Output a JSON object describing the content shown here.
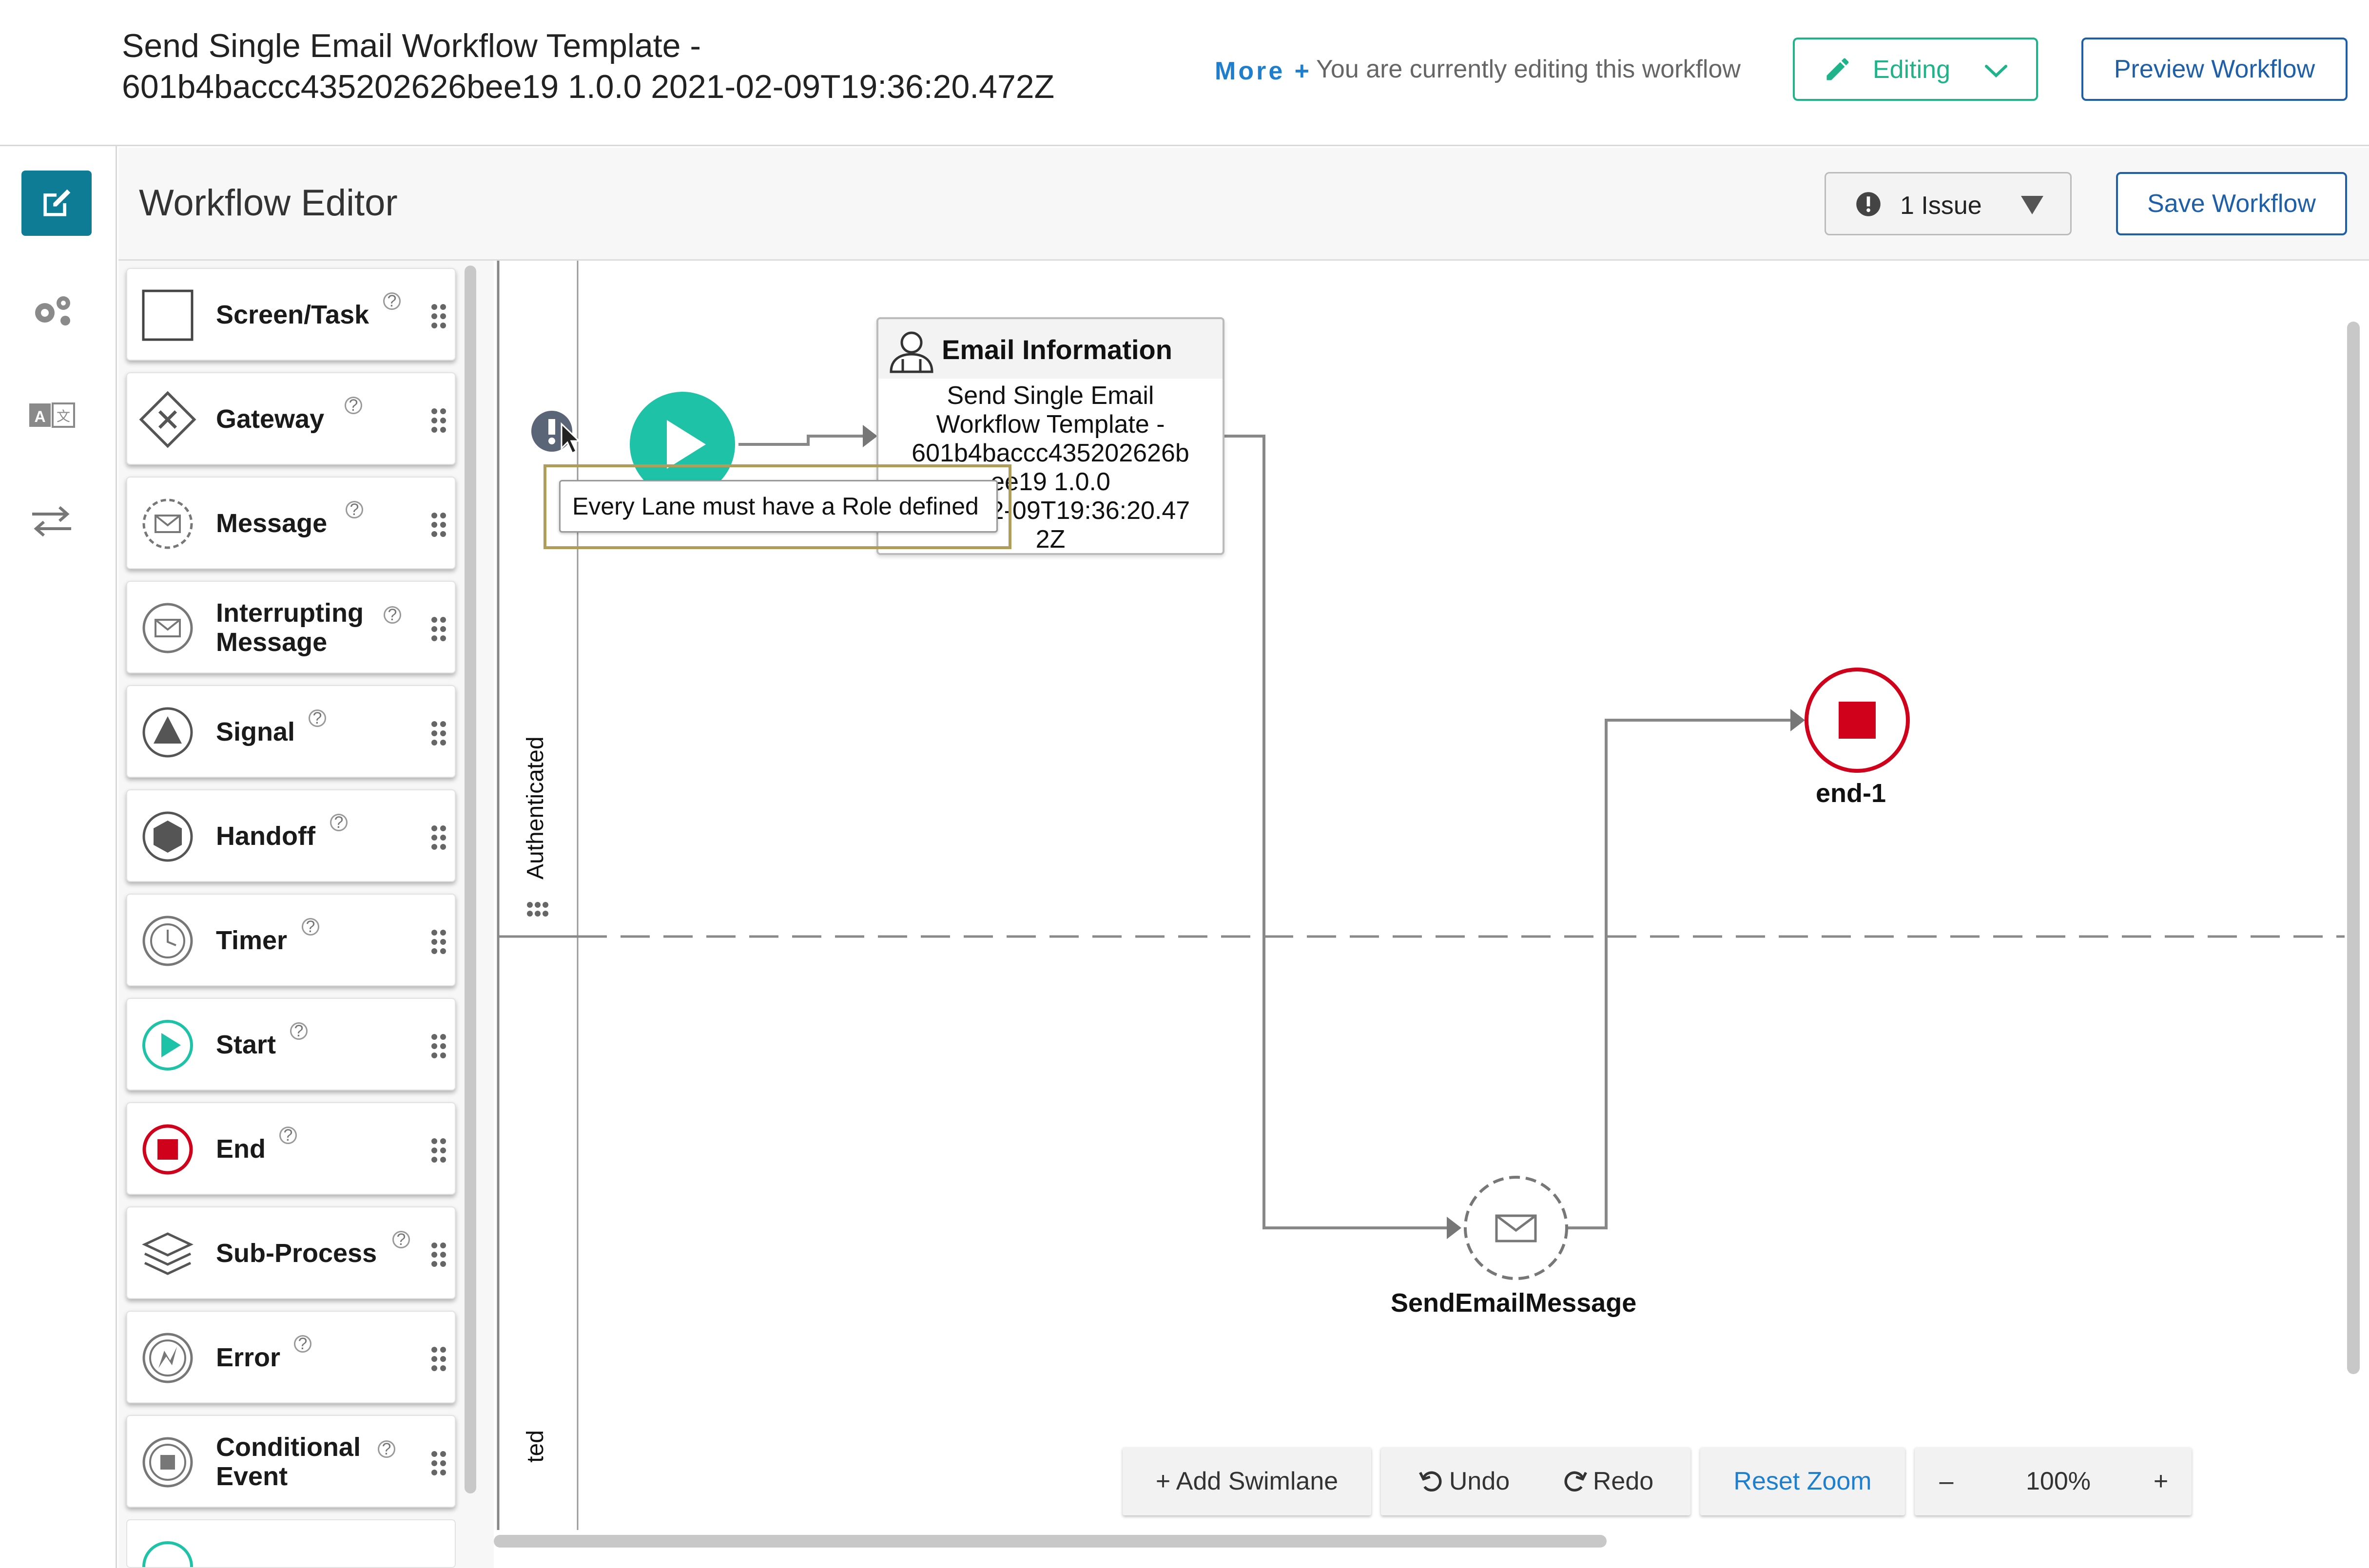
{
  "header": {
    "title_line1": "Send Single Email Workflow Template -",
    "title_line2": "601b4baccc435202626bee19 1.0.0 2021-02-09T19:36:20.472Z",
    "more_link": "More +",
    "editing_notice": "You are currently editing this workflow",
    "editing_button": "Editing",
    "preview_button": "Preview Workflow"
  },
  "editor": {
    "title": "Workflow Editor",
    "issues_button": "1 Issue",
    "save_button": "Save Workflow"
  },
  "palette": [
    {
      "label": "Screen/Task",
      "icon": "screen-task-icon"
    },
    {
      "label": "Gateway",
      "icon": "gateway-icon"
    },
    {
      "label": "Message",
      "icon": "message-icon"
    },
    {
      "label": "Interrupting\nMessage",
      "icon": "interrupting-message-icon"
    },
    {
      "label": "Signal",
      "icon": "signal-icon"
    },
    {
      "label": "Handoff",
      "icon": "handoff-icon"
    },
    {
      "label": "Timer",
      "icon": "timer-icon"
    },
    {
      "label": "Start",
      "icon": "start-icon"
    },
    {
      "label": "End",
      "icon": "end-icon"
    },
    {
      "label": "Sub-Process",
      "icon": "sub-process-icon"
    },
    {
      "label": "Error",
      "icon": "error-icon"
    },
    {
      "label": "Conditional\nEvent",
      "icon": "conditional-event-icon"
    }
  ],
  "canvas": {
    "lane_label": "Authenticated",
    "lane_label_partial": "ted",
    "tooltip": "Every Lane must have a Role defined",
    "task": {
      "title": "Email Information",
      "body": [
        "Send Single Email",
        "Workflow Template -",
        "601b4baccc435202626b",
        "ee19 1.0.0",
        "2021-02-09T19:36:20.47",
        "2Z"
      ]
    },
    "end_label": "end-1",
    "message_label": "SendEmailMessage"
  },
  "toolbar": {
    "add_swimlane": "+ Add Swimlane",
    "undo": "Undo",
    "redo": "Redo",
    "reset_zoom": "Reset Zoom",
    "zoom_out": "–",
    "zoom_level": "100%",
    "zoom_in": "+"
  },
  "colors": {
    "accent": "#0f7c96",
    "teal": "#1ec3a7",
    "end_red": "#d0021b",
    "link_blue": "#1f7fcf",
    "editing_green": "#1fb389"
  }
}
